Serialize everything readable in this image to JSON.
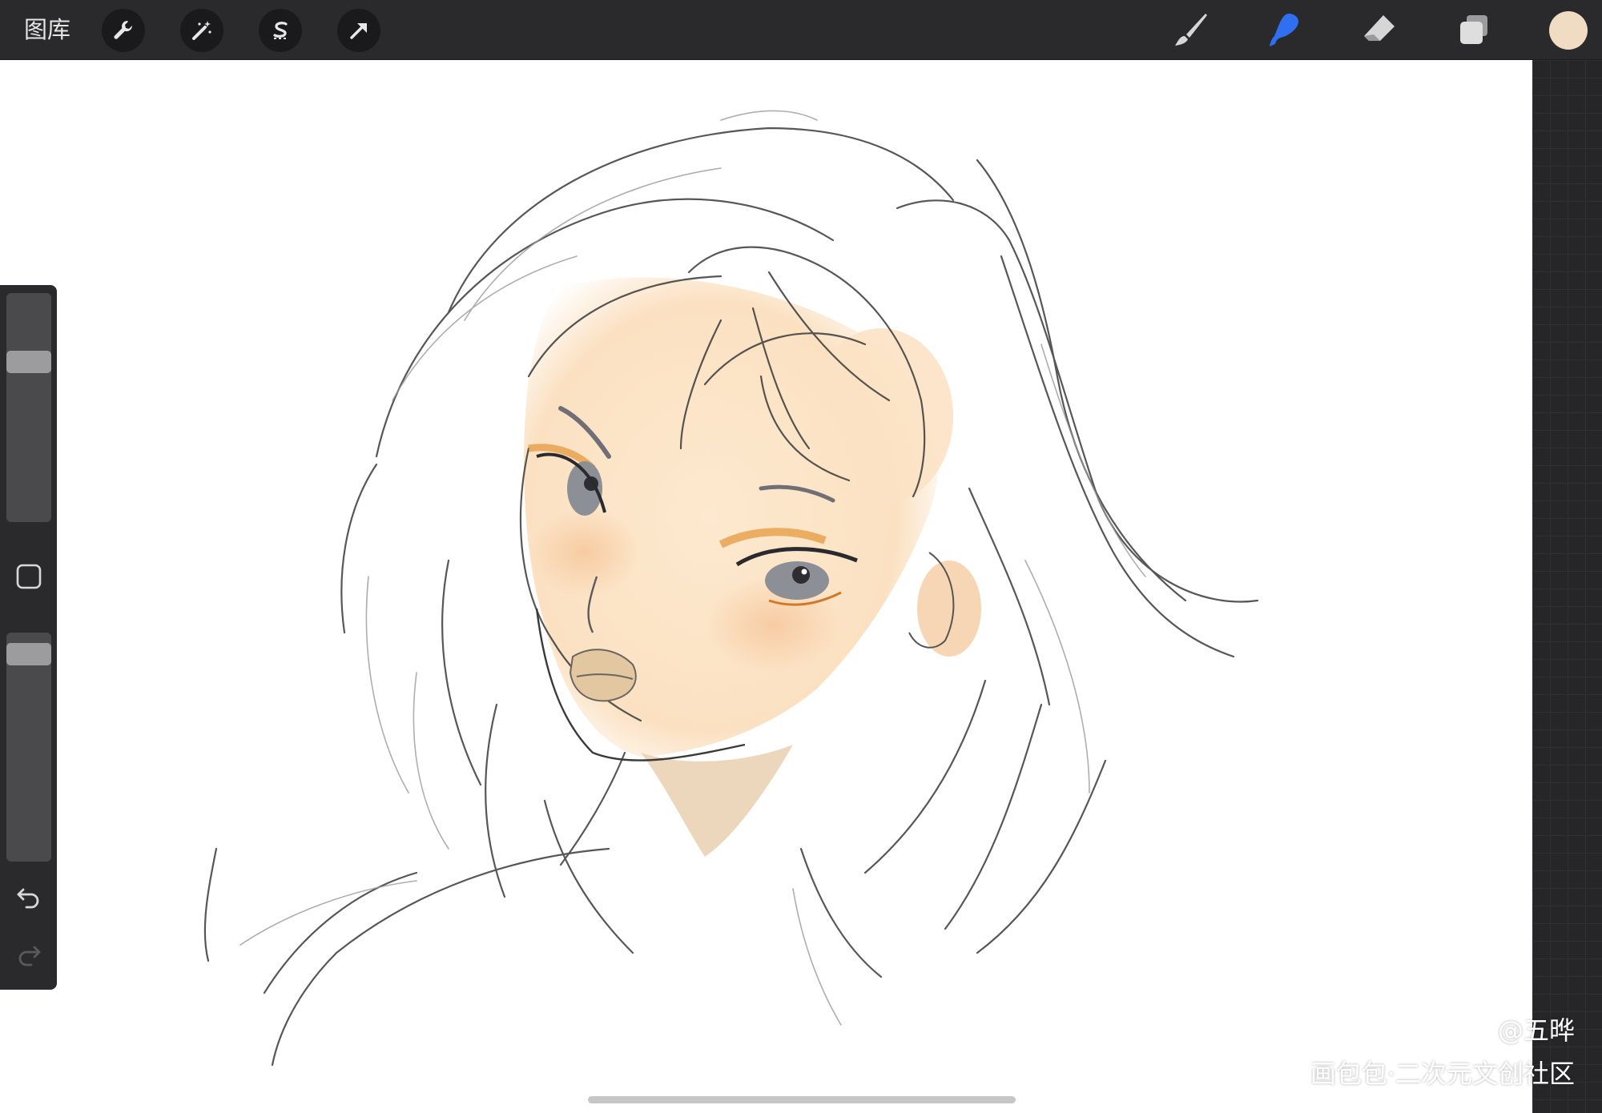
{
  "toolbar": {
    "gallery_label": "图库",
    "left_tools": [
      {
        "icon": "wrench-icon"
      },
      {
        "icon": "magic-wand-icon"
      },
      {
        "icon": "selection-s-icon"
      },
      {
        "icon": "move-arrow-icon"
      }
    ],
    "right_tools": [
      {
        "icon": "brush-icon",
        "active": false
      },
      {
        "icon": "smudge-icon",
        "active": true
      },
      {
        "icon": "eraser-icon",
        "active": false
      },
      {
        "icon": "layers-icon",
        "active": false
      }
    ],
    "current_color": "#f0dcc3",
    "active_color": "#2f6ff0"
  },
  "sidebar": {
    "brush_size_level": 0.72,
    "opacity_level": 0.95
  },
  "watermark": {
    "author": "@五晔",
    "site": "画包包·二次元文创社区"
  }
}
